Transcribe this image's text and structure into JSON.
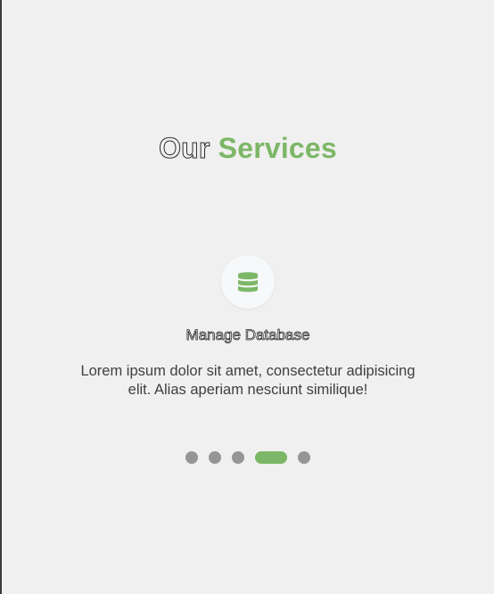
{
  "section": {
    "title_part1": "Our",
    "title_part2": "Services",
    "accent_color": "#7cb767"
  },
  "service": {
    "icon": "database-icon",
    "title": "Manage Database",
    "description": "Lorem ipsum dolor sit amet, consectetur adipisicing elit. Alias aperiam nesciunt similique!"
  },
  "carousel": {
    "slide_count": 5,
    "active_index": 3
  }
}
